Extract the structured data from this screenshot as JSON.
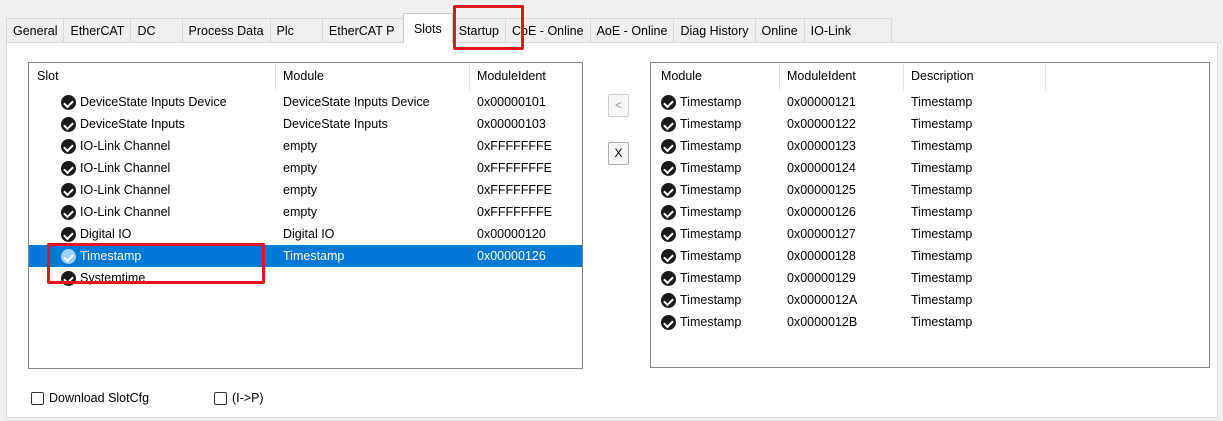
{
  "tabs": [
    {
      "label": "General"
    },
    {
      "label": "EtherCAT"
    },
    {
      "label": "DC"
    },
    {
      "label": "Process Data"
    },
    {
      "label": "Plc"
    },
    {
      "label": "EtherCAT P"
    },
    {
      "label": "Slots"
    },
    {
      "label": "Startup"
    },
    {
      "label": "CoE - Online"
    },
    {
      "label": "AoE - Online"
    },
    {
      "label": "Diag History"
    },
    {
      "label": "Online"
    },
    {
      "label": "IO-Link"
    }
  ],
  "active_tab": "Slots",
  "slots_list": {
    "headers": {
      "slot": "Slot",
      "module": "Module",
      "ident": "ModuleIdent"
    },
    "rows": [
      {
        "slot": "DeviceState Inputs Device",
        "module": "DeviceState Inputs Device",
        "ident": "0x00000101",
        "icon": "module-icon"
      },
      {
        "slot": "DeviceState Inputs",
        "module": "DeviceState Inputs",
        "ident": "0x00000103",
        "icon": "module-icon"
      },
      {
        "slot": "IO-Link Channel",
        "module": "empty",
        "ident": "0xFFFFFFFE",
        "icon": "module-icon"
      },
      {
        "slot": "IO-Link Channel",
        "module": "empty",
        "ident": "0xFFFFFFFE",
        "icon": "module-icon"
      },
      {
        "slot": "IO-Link Channel",
        "module": "empty",
        "ident": "0xFFFFFFFE",
        "icon": "module-icon"
      },
      {
        "slot": "IO-Link Channel",
        "module": "empty",
        "ident": "0xFFFFFFFE",
        "icon": "module-icon"
      },
      {
        "slot": "Digital IO",
        "module": "Digital IO",
        "ident": "0x00000120",
        "icon": "module-icon"
      },
      {
        "slot": "Timestamp",
        "module": "Timestamp",
        "ident": "0x00000126",
        "icon": "module-icon",
        "selected": true
      },
      {
        "slot": "Systemtime",
        "module": "",
        "ident": "",
        "icon": "module-icon"
      }
    ]
  },
  "buttons": {
    "insert": "<",
    "remove": "X"
  },
  "modules_list": {
    "headers": {
      "module": "Module",
      "ident": "ModuleIdent",
      "description": "Description"
    },
    "rows": [
      {
        "module": "Timestamp",
        "ident": "0x00000121",
        "description": "Timestamp"
      },
      {
        "module": "Timestamp",
        "ident": "0x00000122",
        "description": "Timestamp"
      },
      {
        "module": "Timestamp",
        "ident": "0x00000123",
        "description": "Timestamp"
      },
      {
        "module": "Timestamp",
        "ident": "0x00000124",
        "description": "Timestamp"
      },
      {
        "module": "Timestamp",
        "ident": "0x00000125",
        "description": "Timestamp"
      },
      {
        "module": "Timestamp",
        "ident": "0x00000126",
        "description": "Timestamp"
      },
      {
        "module": "Timestamp",
        "ident": "0x00000127",
        "description": "Timestamp"
      },
      {
        "module": "Timestamp",
        "ident": "0x00000128",
        "description": "Timestamp"
      },
      {
        "module": "Timestamp",
        "ident": "0x00000129",
        "description": "Timestamp"
      },
      {
        "module": "Timestamp",
        "ident": "0x0000012A",
        "description": "Timestamp"
      },
      {
        "module": "Timestamp",
        "ident": "0x0000012B",
        "description": "Timestamp"
      }
    ]
  },
  "checkboxes": {
    "download_slotcfg": {
      "label": "Download SlotCfg",
      "checked": false
    },
    "i_to_p": {
      "label": "(I->P)",
      "checked": false
    }
  },
  "colors": {
    "selection": "#0078d7",
    "highlight_box": "#e3141b"
  }
}
